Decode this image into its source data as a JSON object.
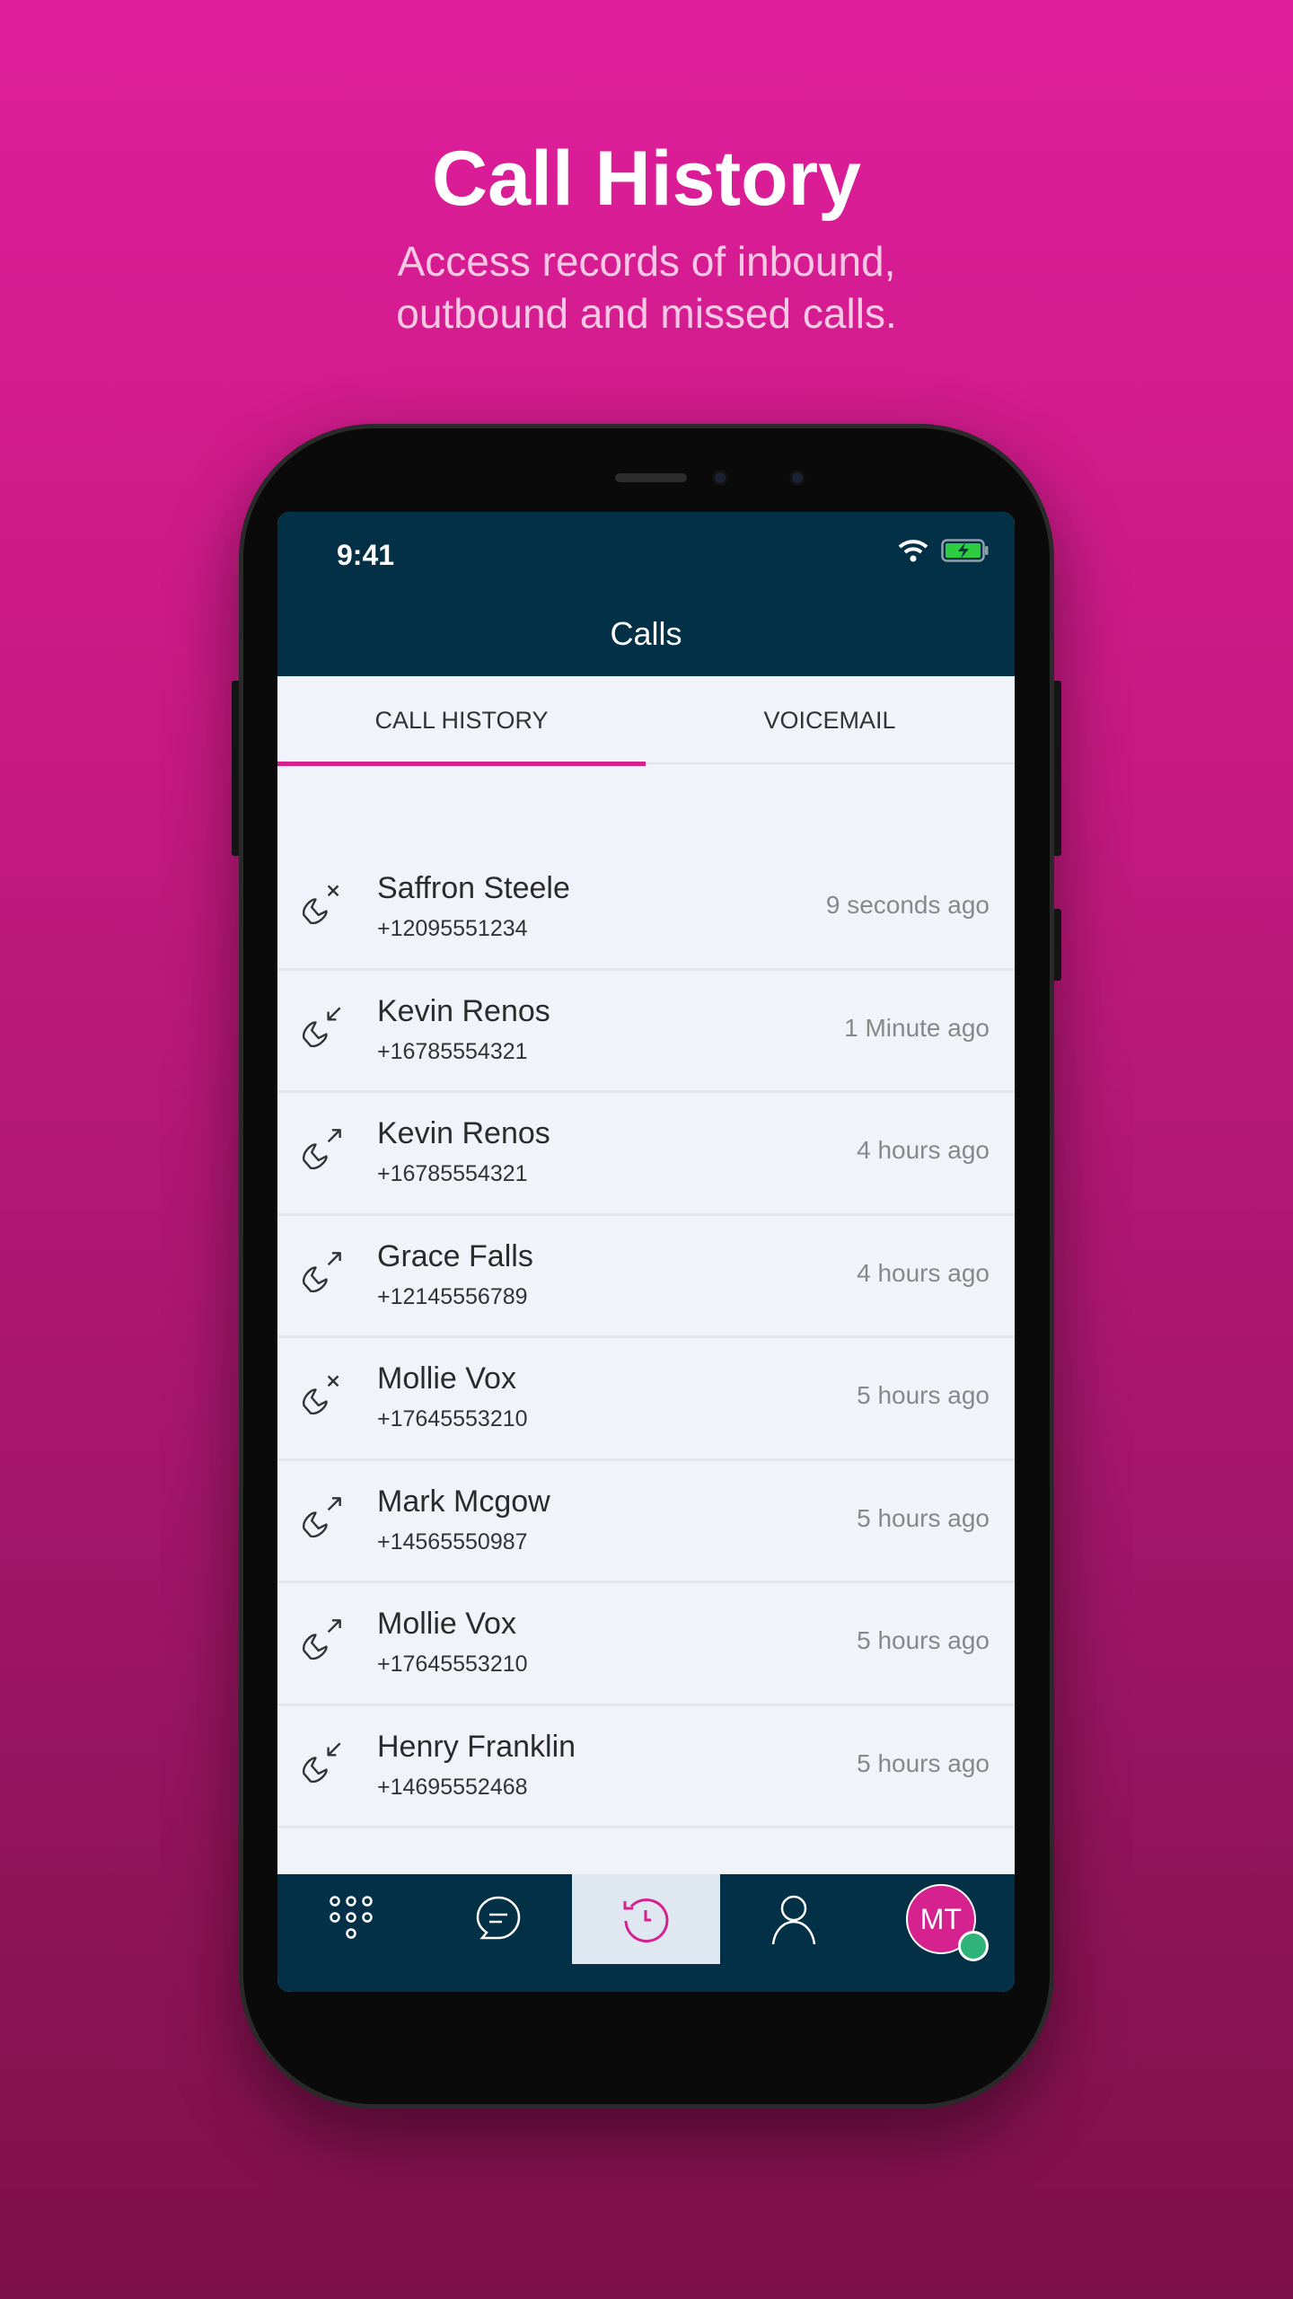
{
  "hero": {
    "title": "Call History",
    "subtitle_line1": "Access records of inbound,",
    "subtitle_line2": "outbound and missed calls."
  },
  "status_bar": {
    "time": "9:41",
    "wifi": "wifi-icon",
    "battery": "battery-charging-icon"
  },
  "header": {
    "title": "Calls"
  },
  "tabs": [
    {
      "label": "CALL HISTORY",
      "active": true
    },
    {
      "label": "VOICEMAIL",
      "active": false
    }
  ],
  "calls": [
    {
      "name": "Saffron Steele",
      "number": "+12095551234",
      "time": "9 seconds ago",
      "type": "missed"
    },
    {
      "name": "Kevin Renos",
      "number": "+16785554321",
      "time": "1 Minute ago",
      "type": "incoming"
    },
    {
      "name": "Kevin Renos",
      "number": "+16785554321",
      "time": "4 hours ago",
      "type": "outgoing"
    },
    {
      "name": "Grace Falls",
      "number": "+12145556789",
      "time": "4 hours ago",
      "type": "outgoing"
    },
    {
      "name": "Mollie Vox",
      "number": "+17645553210",
      "time": "5 hours ago",
      "type": "missed"
    },
    {
      "name": "Mark Mcgow",
      "number": "+14565550987",
      "time": "5 hours ago",
      "type": "outgoing"
    },
    {
      "name": "Mollie Vox",
      "number": "+17645553210",
      "time": "5 hours ago",
      "type": "outgoing"
    },
    {
      "name": "Henry Franklin",
      "number": "+14695552468",
      "time": "5 hours ago",
      "type": "incoming"
    }
  ],
  "bottom_nav": {
    "items": [
      "keypad-icon",
      "chat-icon",
      "history-icon",
      "contacts-icon",
      "profile-avatar"
    ],
    "active": "history-icon",
    "avatar_initials": "MT",
    "presence": "online"
  },
  "colors": {
    "accent": "#d6228f",
    "header": "#023047",
    "presence": "#2fb37a"
  }
}
